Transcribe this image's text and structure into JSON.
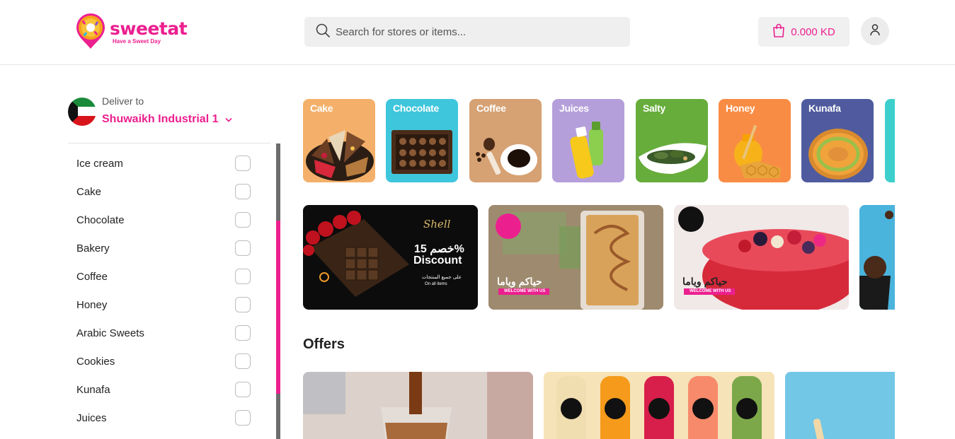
{
  "header": {
    "logo_name": "sweetat",
    "logo_tagline": "Have a Sweet Day",
    "search_placeholder": "Search for stores or items...",
    "cart_total": "0.000 KD"
  },
  "delivery": {
    "label": "Deliver to",
    "location": "Shuwaikh Industrial 1"
  },
  "filters": [
    {
      "label": "Ice cream",
      "checked": false
    },
    {
      "label": "Cake",
      "checked": false
    },
    {
      "label": "Chocolate",
      "checked": false
    },
    {
      "label": "Bakery",
      "checked": false
    },
    {
      "label": "Coffee",
      "checked": false
    },
    {
      "label": "Honey",
      "checked": false
    },
    {
      "label": "Arabic Sweets",
      "checked": false
    },
    {
      "label": "Cookies",
      "checked": false
    },
    {
      "label": "Kunafa",
      "checked": false
    },
    {
      "label": "Juices",
      "checked": false
    }
  ],
  "categories": [
    {
      "label": "Cake",
      "color": "#f4b06a"
    },
    {
      "label": "Chocolate",
      "color": "#3ec6dc"
    },
    {
      "label": "Coffee",
      "color": "#d6a173"
    },
    {
      "label": "Juices",
      "color": "#b59fdb"
    },
    {
      "label": "Salty",
      "color": "#67ad3c"
    },
    {
      "label": "Honey",
      "color": "#f98c44"
    },
    {
      "label": "Kunafa",
      "color": "#4f5b9e"
    },
    {
      "label": "",
      "color": "#3ccfcc"
    }
  ],
  "banners": [
    {
      "brand": "Shell",
      "title_ar": "خصم 15%",
      "title_en": "Discount",
      "sub_ar": "على جميع المنتجات",
      "sub_en": "On all items"
    },
    {
      "greeting_ar": "حياكم وياما",
      "welcome": "WELCOME WITH US"
    },
    {
      "greeting_ar": "حياكم وياما",
      "welcome": "WELCOME WITH US"
    },
    {}
  ],
  "offers_title": "Offers",
  "colors": {
    "brand": "#ec1f8f"
  }
}
